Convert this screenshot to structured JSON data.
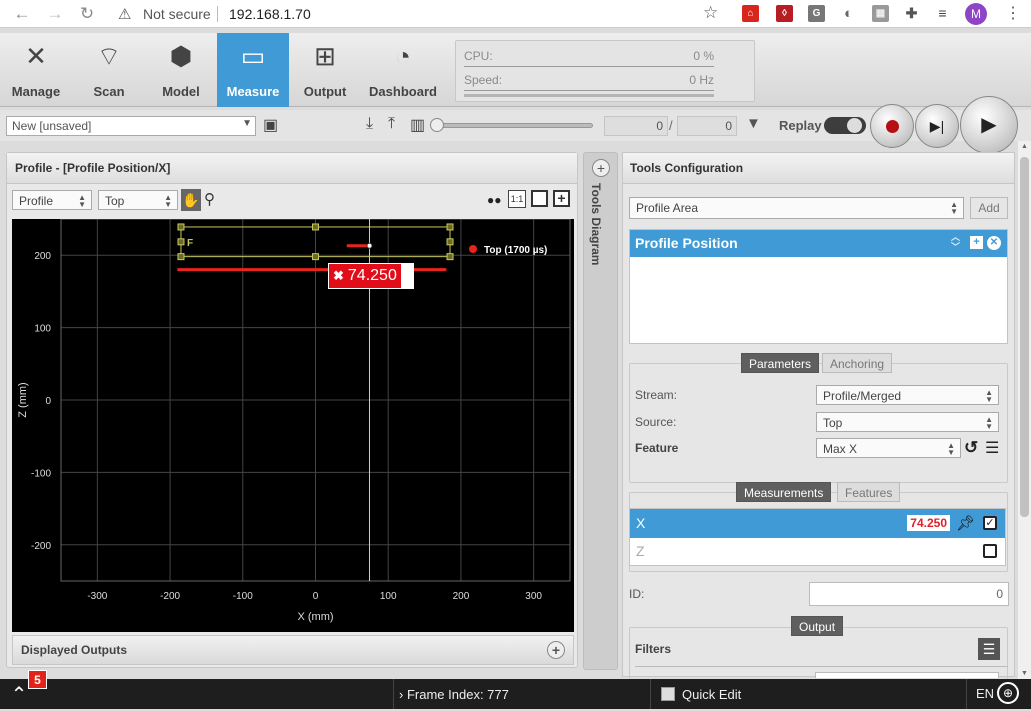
{
  "browser": {
    "back": "←",
    "forward": "→",
    "reload": "↻",
    "security_icon": "warning-icon",
    "security_text": "Not secure",
    "url": "192.168.1.70",
    "avatar_letter": "M",
    "ext_labels": [
      "",
      "",
      "G",
      "",
      "",
      "",
      ""
    ]
  },
  "nav": {
    "tabs": [
      {
        "label": "Manage",
        "icon": "tools-icon"
      },
      {
        "label": "Scan",
        "icon": "scanner-icon"
      },
      {
        "label": "Model",
        "icon": "cubes-icon"
      },
      {
        "label": "Measure",
        "icon": "ruler-icon"
      },
      {
        "label": "Output",
        "icon": "network-icon"
      },
      {
        "label": "Dashboard",
        "icon": "gauge-icon"
      }
    ],
    "active": "Measure"
  },
  "stats": {
    "cpu_label": "CPU:",
    "cpu_value": "0 %",
    "speed_label": "Speed:",
    "speed_value": "0 Hz"
  },
  "toolbar": {
    "job": "New [unsaved]",
    "frame_current": "0",
    "frame_sep": "/",
    "frame_total": "0",
    "replay_label": "Replay"
  },
  "profile_panel": {
    "title": "Profile - [Profile Position/X]",
    "view_select": "Profile",
    "source_select": "Top",
    "displayed_outputs": "Displayed Outputs"
  },
  "tools_diagram": {
    "label": "Tools Diagram"
  },
  "chart_data": {
    "type": "scatter",
    "title": "",
    "xlabel": "X (mm)",
    "ylabel": "Z (mm)",
    "xlim": [
      -350,
      350
    ],
    "ylim": [
      -250,
      250
    ],
    "x_ticks": [
      -300,
      -200,
      -100,
      0,
      100,
      200,
      300
    ],
    "y_ticks": [
      200,
      100,
      0,
      -100,
      -200
    ],
    "grid": true,
    "legend_position": "top-right",
    "series": [
      {
        "name": "Top (1700 µs)",
        "color": "#e8241c",
        "segments": [
          [
            [
              -190,
              180
            ],
            [
              180,
              180
            ]
          ],
          [
            [
              43,
              213
            ],
            [
              75,
              213
            ]
          ]
        ]
      }
    ],
    "region": {
      "label": "F",
      "x": [
        -185,
        185
      ],
      "y": [
        198,
        239
      ],
      "color": "#c8c860"
    },
    "marker_x": 74.25,
    "readout": "74.250"
  },
  "tools_config": {
    "title": "Tools Configuration",
    "tool_type": "Profile Area",
    "add_label": "Add",
    "selected_tool": "Profile Position",
    "tabs1": [
      "Parameters",
      "Anchoring"
    ],
    "stream_label": "Stream:",
    "stream_value": "Profile/Merged",
    "source_label": "Source:",
    "source_value": "Top",
    "feature_label": "Feature",
    "feature_value": "Max X",
    "tabs2": [
      "Measurements",
      "Features"
    ],
    "measurements": [
      {
        "name": "X",
        "value": "74.250",
        "checked": true
      },
      {
        "name": "Z",
        "value": "",
        "checked": false
      }
    ],
    "id_label": "ID:",
    "id_value": "0",
    "output_label": "Output",
    "filters_label": "Filters"
  },
  "statusbar": {
    "badge": "5",
    "frame_index": "Frame Index: 777",
    "quick_edit": "Quick Edit",
    "lang": "EN"
  }
}
